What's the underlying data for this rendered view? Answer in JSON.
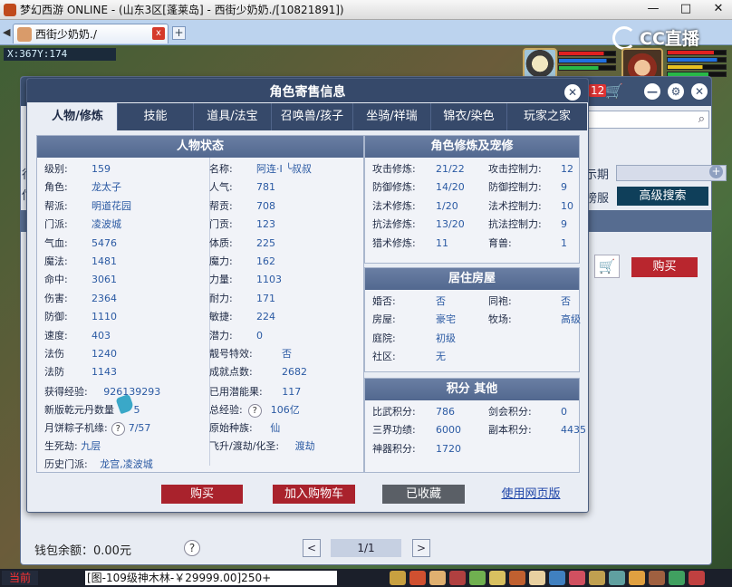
{
  "window": {
    "title": "梦幻西游 ONLINE - (山东3区[蓬莱岛] - 西街少奶奶./[10821891])",
    "controls": [
      "—",
      "□",
      "✕"
    ]
  },
  "browser_tab": {
    "label": "西街少奶奶./",
    "close": "x",
    "add": "+"
  },
  "game": {
    "coordinates": "X:367Y:174",
    "watermark": "CC直播"
  },
  "shop": {
    "badge": "12",
    "controls": [
      "—",
      "⚙",
      "✕"
    ],
    "partial_labels": [
      "示期",
      "榜服",
      "行",
      "估"
    ],
    "advanced_search": "高级搜索",
    "buy": "购买",
    "wallet_label": "钱包余额：0.00元",
    "help": "?",
    "page": "1/1",
    "prev": "<",
    "next": ">"
  },
  "modal": {
    "title": "角色寄售信息",
    "close": "✕",
    "tabs": [
      {
        "label": "人物/修炼",
        "active": true
      },
      {
        "label": "技能",
        "active": false
      },
      {
        "label": "道具/法宝",
        "active": false
      },
      {
        "label": "召唤兽/孩子",
        "active": false
      },
      {
        "label": "坐骑/祥瑞",
        "active": false
      },
      {
        "label": "锦衣/染色",
        "active": false
      },
      {
        "label": "玩家之家",
        "active": false
      }
    ],
    "status": {
      "header": "人物状态",
      "left": [
        {
          "k": "级别:",
          "v": "159"
        },
        {
          "k": "角色:",
          "v": "龙太子"
        },
        {
          "k": "帮派:",
          "v": "明道花园"
        },
        {
          "k": "门派:",
          "v": "凌波城"
        },
        {
          "k": "气血:",
          "v": "5476"
        },
        {
          "k": "魔法:",
          "v": "1481"
        },
        {
          "k": "命中:",
          "v": "3061"
        },
        {
          "k": "伤害:",
          "v": "2364"
        },
        {
          "k": "防御:",
          "v": "1110"
        },
        {
          "k": "速度:",
          "v": "403"
        },
        {
          "k": "法伤",
          "v": "1240"
        },
        {
          "k": "法防",
          "v": "1143"
        }
      ],
      "right": [
        {
          "k": "名称:",
          "v": "阿连·I ╰叔叔"
        },
        {
          "k": "人气:",
          "v": "781"
        },
        {
          "k": "帮贡:",
          "v": "708"
        },
        {
          "k": "门贡:",
          "v": "123"
        },
        {
          "k": "体质:",
          "v": "225"
        },
        {
          "k": "魔力:",
          "v": "162"
        },
        {
          "k": "力量:",
          "v": "1103"
        },
        {
          "k": "耐力:",
          "v": "171"
        },
        {
          "k": "敏捷:",
          "v": "224"
        },
        {
          "k": "潜力:",
          "v": "0"
        },
        {
          "k": "靓号特效:",
          "v": "否"
        },
        {
          "k": "成就点数:",
          "v": "2682"
        }
      ],
      "extra": {
        "exp_k": "获得经验:",
        "exp_v": "926139293",
        "pot_k": "已用潜能果:",
        "pot_v": "117",
        "dan_k": "新版乾元丹数量",
        "dan_v": "5",
        "total_k": "总经验:",
        "total_v": "106亿",
        "mooncake_k": "月饼粽子机缘:",
        "mooncake_v": "7/57",
        "race_k": "原始种族:",
        "race_v": "仙",
        "sisha_k": "生死劫:",
        "sisha_v": "九层",
        "fly_k": "飞升/渡劫/化圣:",
        "fly_v": "渡劫",
        "history_k": "历史门派:",
        "history_v": "龙宫,凌波城",
        "help": "?"
      }
    },
    "cultivation": {
      "header": "角色修炼及宠修",
      "rows": [
        {
          "k1": "攻击修炼:",
          "v1": "21/22",
          "k2": "攻击控制力:",
          "v2": "12"
        },
        {
          "k1": "防御修炼:",
          "v1": "14/20",
          "k2": "防御控制力:",
          "v2": "9"
        },
        {
          "k1": "法术修炼:",
          "v1": "1/20",
          "k2": "法术控制力:",
          "v2": "10"
        },
        {
          "k1": "抗法修炼:",
          "v1": "13/20",
          "k2": "抗法控制力:",
          "v2": "9"
        },
        {
          "k1": "猎术修炼:",
          "v1": "11",
          "k2": "育兽:",
          "v2": "1"
        }
      ]
    },
    "housing": {
      "header": "居住房屋",
      "rows": [
        {
          "k1": "婚否:",
          "v1": "否",
          "k2": "同袍:",
          "v2": "否"
        },
        {
          "k1": "房屋:",
          "v1": "豪宅",
          "k2": "牧场:",
          "v2": "高级"
        },
        {
          "k1": "庭院:",
          "v1": "初级",
          "k2": "",
          "v2": ""
        },
        {
          "k1": "社区:",
          "v1": "无",
          "k2": "",
          "v2": ""
        }
      ]
    },
    "points": {
      "header": "积分 其他",
      "rows": [
        {
          "k1": "比武积分:",
          "v1": "786",
          "k2": "剑会积分:",
          "v2": "0"
        },
        {
          "k1": "三界功绩:",
          "v1": "6000",
          "k2": "副本积分:",
          "v2": "4435"
        },
        {
          "k1": "神器积分:",
          "v1": "1720",
          "k2": "",
          "v2": ""
        }
      ]
    },
    "buttons": {
      "buy": "购买",
      "add_cart": "加入购物车",
      "favorited": "已收藏",
      "web": "使用网页版"
    }
  },
  "taskbar": {
    "current": "当前",
    "chat": "[图-109级神木林-￥29999.00]250+"
  }
}
